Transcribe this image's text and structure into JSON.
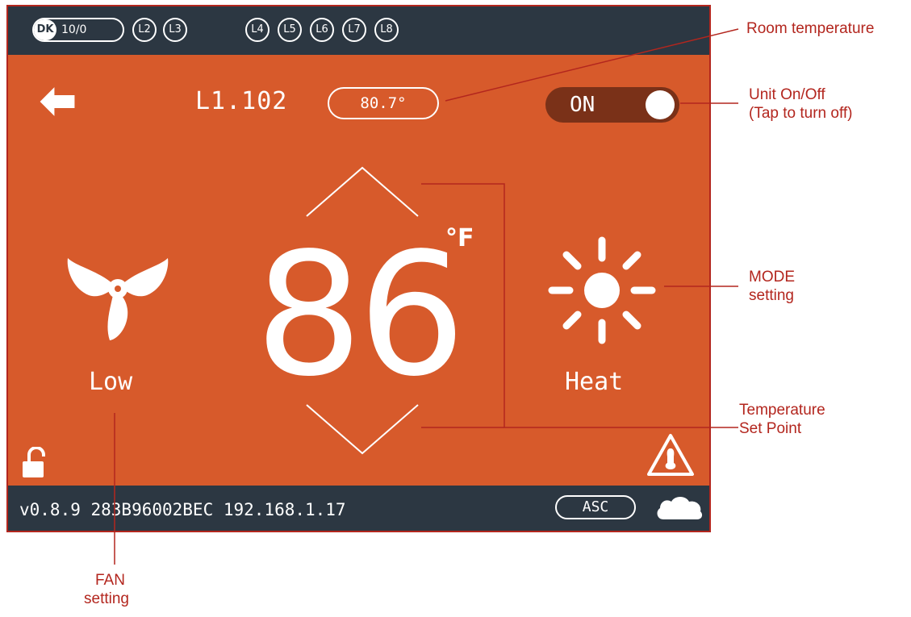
{
  "topbar": {
    "dk_label": "DK",
    "dk_value": "10/0",
    "levels": [
      "L2",
      "L3",
      "L4",
      "L5",
      "L6",
      "L7",
      "L8"
    ]
  },
  "header": {
    "room_name": "L1.102",
    "room_temperature": "80.7°",
    "power_label": "ON"
  },
  "setpoint": {
    "value": "86",
    "unit": "°F"
  },
  "fan": {
    "label": "Low",
    "icon": "fan-icon"
  },
  "mode": {
    "label": "Heat",
    "icon": "sun-icon"
  },
  "footer": {
    "info": "v0.8.9 283B96002BEC 192.168.1.17",
    "asc_label": "ASC"
  },
  "annotations": {
    "room_temperature": "Room temperature",
    "unit_onoff_1": "Unit On/Off",
    "unit_onoff_2": "(Tap to turn off)",
    "mode_1": "MODE",
    "mode_2": "setting",
    "setpoint_1": "Temperature",
    "setpoint_2": "Set Point",
    "fan_1": "FAN",
    "fan_2": "setting"
  },
  "colors": {
    "screen_bg": "#d75a2b",
    "bar_bg": "#2c3742",
    "toggle_bg": "#7a3118",
    "annotation": "#b3261e"
  }
}
